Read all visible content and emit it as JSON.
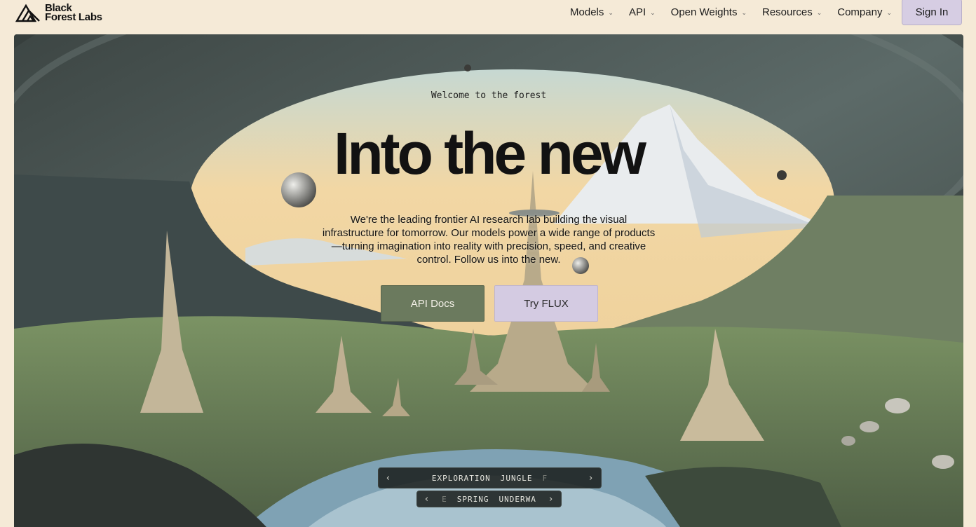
{
  "brand": {
    "line1": "Black",
    "line2": "Forest Labs"
  },
  "nav": {
    "items": [
      {
        "label": "Models"
      },
      {
        "label": "API"
      },
      {
        "label": "Open Weights"
      },
      {
        "label": "Resources"
      },
      {
        "label": "Company"
      }
    ],
    "signin_label": "Sign In"
  },
  "hero": {
    "welcome": "Welcome to the forest",
    "headline": "Into the new",
    "lede": "We're the leading frontier AI research lab building the visual infrastructure for tomorrow. Our models power a wide range of products—turning imagination into reality with precision, speed, and creative control. Follow us into the new.",
    "buttons": {
      "api_docs": "API Docs",
      "try_flux": "Try FLUX"
    }
  },
  "carousel": {
    "row1": {
      "words": [
        "EXPLORATION",
        "JUNGLE",
        "F"
      ]
    },
    "row2": {
      "words": [
        "E",
        "SPRING",
        "UNDERWA"
      ]
    }
  },
  "colors": {
    "page_bg": "#f5ead7",
    "signin_bg": "#d6cde3",
    "api_button": "#6b7a5e",
    "flux_button": "#d4cbe2"
  }
}
